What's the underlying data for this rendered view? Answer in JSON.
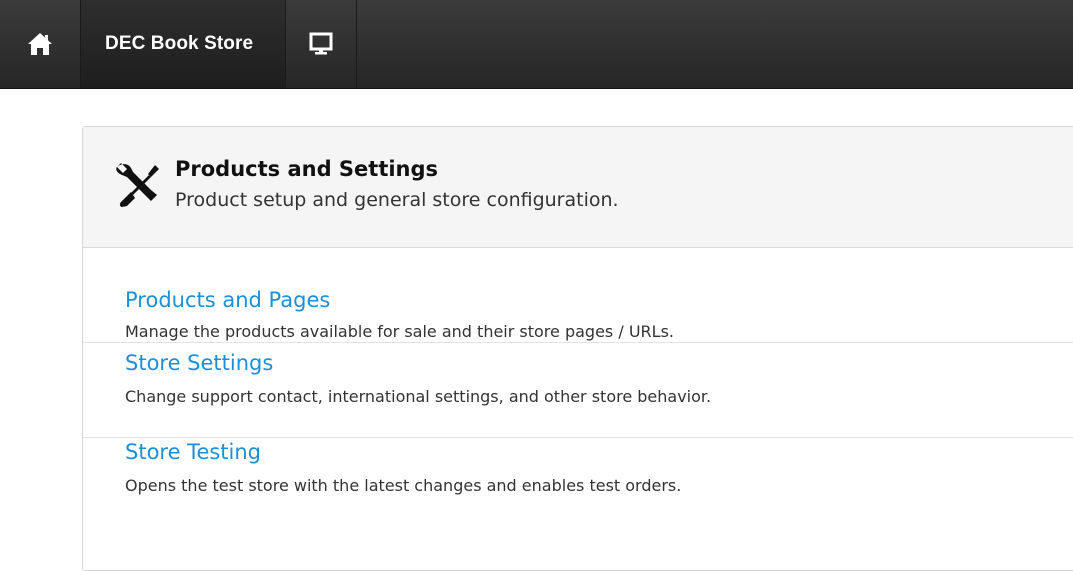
{
  "topbar": {
    "home_icon": "home-icon",
    "store_label": "DEC Book Store",
    "screen_icon": "monitor-icon"
  },
  "panel": {
    "icon": "tools-icon",
    "title": "Products and Settings",
    "subtitle": "Product setup and general store configuration.",
    "items": [
      {
        "title": "Products and Pages",
        "description": "Manage the products available for sale and their store pages / URLs."
      },
      {
        "title": "Store Settings",
        "description": "Change support contact, international settings, and other store behavior."
      },
      {
        "title": "Store Testing",
        "description": "Opens the test store with the latest changes and enables test orders."
      }
    ]
  },
  "colors": {
    "topbar": "#2b2b2b",
    "link": "#1a90d9",
    "header_bg": "#f5f5f5"
  }
}
